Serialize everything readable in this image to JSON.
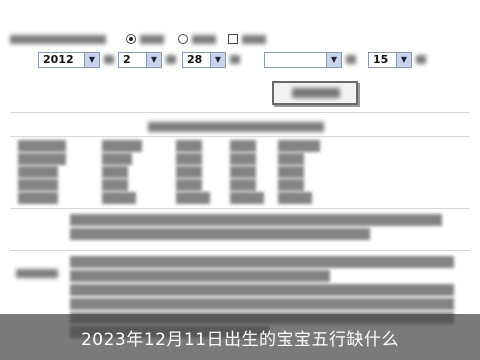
{
  "form": {
    "input_type_label": "",
    "radio_options": [
      {
        "label": "",
        "selected": true
      },
      {
        "label": "",
        "selected": false
      }
    ],
    "checkbox": {
      "label": "",
      "checked": false
    },
    "year": "2012",
    "month": "2",
    "day": "28",
    "hour": "",
    "minute": "15",
    "submit_label": ""
  },
  "result": {
    "title": "",
    "analysis_label": ""
  },
  "caption": "2023年12月11日出生的宝宝五行缺什么"
}
